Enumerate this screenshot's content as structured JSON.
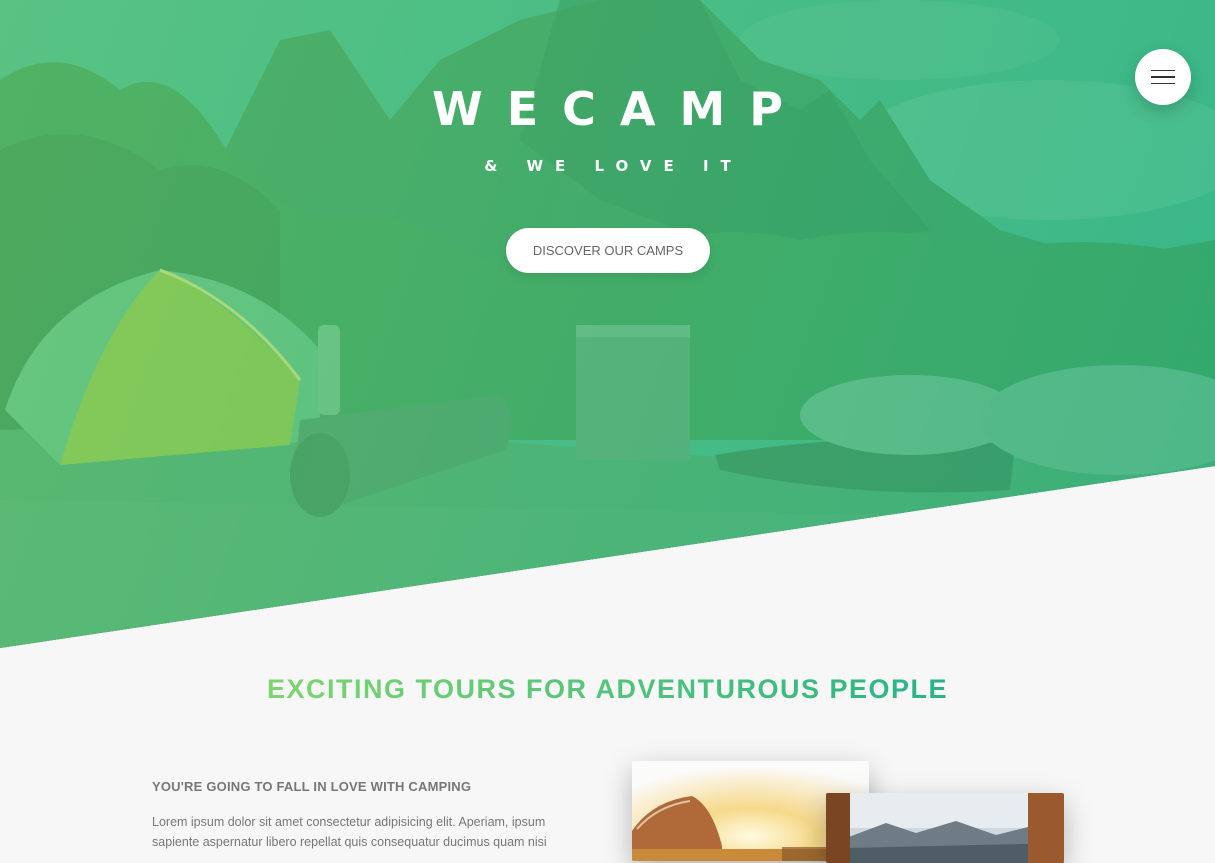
{
  "header": {
    "brand": "WECAMP",
    "tagline": "& WE LOVE IT",
    "cta_label": "DISCOVER OUR CAMPS",
    "menu_icon": "hamburger-menu-icon"
  },
  "about": {
    "title": "EXCITING TOURS FOR ADVENTUROUS PEOPLE",
    "subheading": "YOU'RE GOING TO FALL IN LOVE WITH CAMPING",
    "paragraph": "Lorem ipsum dolor sit amet consectetur adipisicing elit. Aperiam, ipsum sapiente aspernatur libero repellat quis consequatur ducimus quam nisi"
  },
  "colors": {
    "primary_light": "#7ed56f",
    "primary_dark": "#28b485",
    "background": "#f7f7f7"
  }
}
